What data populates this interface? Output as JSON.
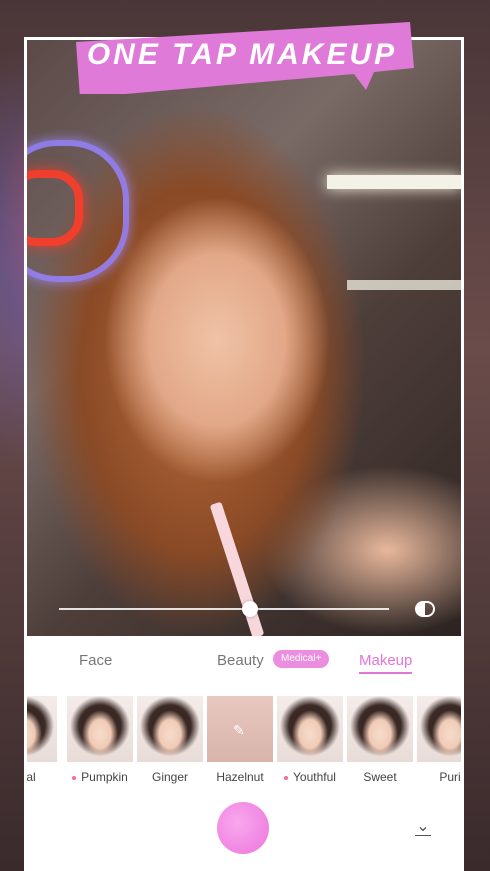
{
  "banner": {
    "text": "ONE TAP MAKEUP"
  },
  "tabs": [
    {
      "label": "Face"
    },
    {
      "label": "Beauty"
    },
    {
      "label": "Makeup"
    }
  ],
  "medical_badge": "Medical+",
  "intensity_level": 0.58,
  "looks": [
    {
      "label": "tural",
      "dot": false
    },
    {
      "label": "Pumpkin",
      "dot": true
    },
    {
      "label": "Ginger",
      "dot": false
    },
    {
      "label": "Hazelnut",
      "dot": false
    },
    {
      "label": "Youthful",
      "dot": true
    },
    {
      "label": "Sweet",
      "dot": false
    },
    {
      "label": "Puri",
      "dot": false
    }
  ],
  "icons": {
    "compare": "compare-icon",
    "edit": "pencil-icon",
    "collapse": "chevron-down-icon"
  },
  "colors": {
    "accent": "#e276d8",
    "badge": "#ec8ee0",
    "shutter": "#ec74dc"
  }
}
